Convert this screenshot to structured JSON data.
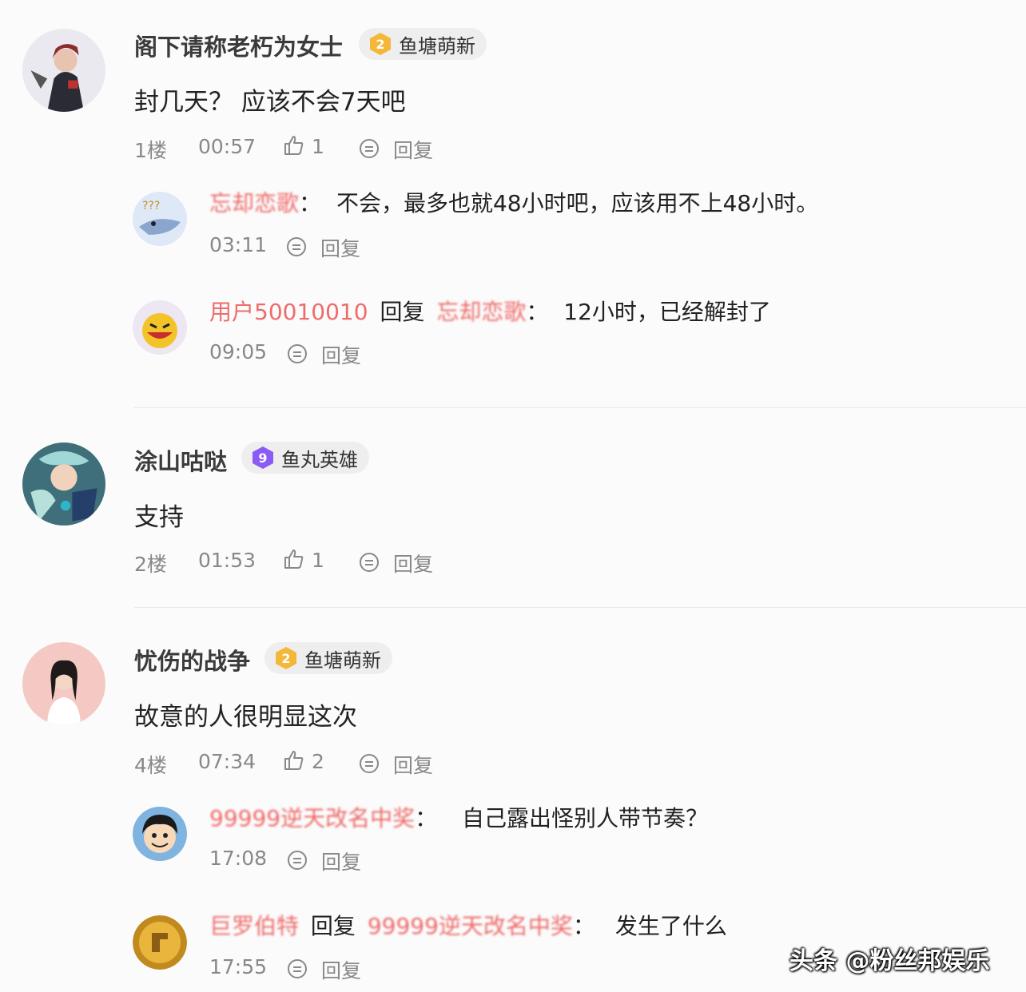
{
  "threads": [
    {
      "author": "阁下请称老朽为女士",
      "badge": {
        "level": "2",
        "name": "鱼塘萌新",
        "color": "#f4b738"
      },
      "text": "封几天？ 应该不会7天吧",
      "floor": "1楼",
      "time": "00:57",
      "likes": "1",
      "reply_label": "回复",
      "replies": [
        {
          "user": "忘却恋歌",
          "sep": "：",
          "text": "不会，最多也就48小时吧，应该用不上48小时。",
          "time": "03:11",
          "reply_label": "回复"
        },
        {
          "user": "用户50010010",
          "reply_word": "回复",
          "target": "忘却恋歌",
          "sep": "：",
          "text": "12小时，已经解封了",
          "time": "09:05",
          "reply_label": "回复"
        }
      ]
    },
    {
      "author": "涂山咕哒",
      "badge": {
        "level": "9",
        "name": "鱼丸英雄",
        "color": "#8a5cf5"
      },
      "text": "支持",
      "floor": "2楼",
      "time": "01:53",
      "likes": "1",
      "reply_label": "回复",
      "replies": []
    },
    {
      "author": "忧伤的战争",
      "badge": {
        "level": "2",
        "name": "鱼塘萌新",
        "color": "#f4b738"
      },
      "text": "故意的人很明显这次",
      "floor": "4楼",
      "time": "07:34",
      "likes": "2",
      "reply_label": "回复",
      "replies": [
        {
          "user": "99999逆天改名中奖",
          "sep": "：",
          "text": "自己露出怪别人带节奏？",
          "time": "17:08",
          "reply_label": "回复"
        },
        {
          "user": "巨罗伯特",
          "reply_word": "回复",
          "target": "99999逆天改名中奖",
          "sep": "：",
          "text": "发生了什么",
          "time": "17:55",
          "reply_label": "回复"
        }
      ]
    }
  ],
  "watermark": "头条 @粉丝邦娱乐",
  "icons": {
    "like": "thumbs-up-icon",
    "reply": "comment-bubble-icon"
  }
}
